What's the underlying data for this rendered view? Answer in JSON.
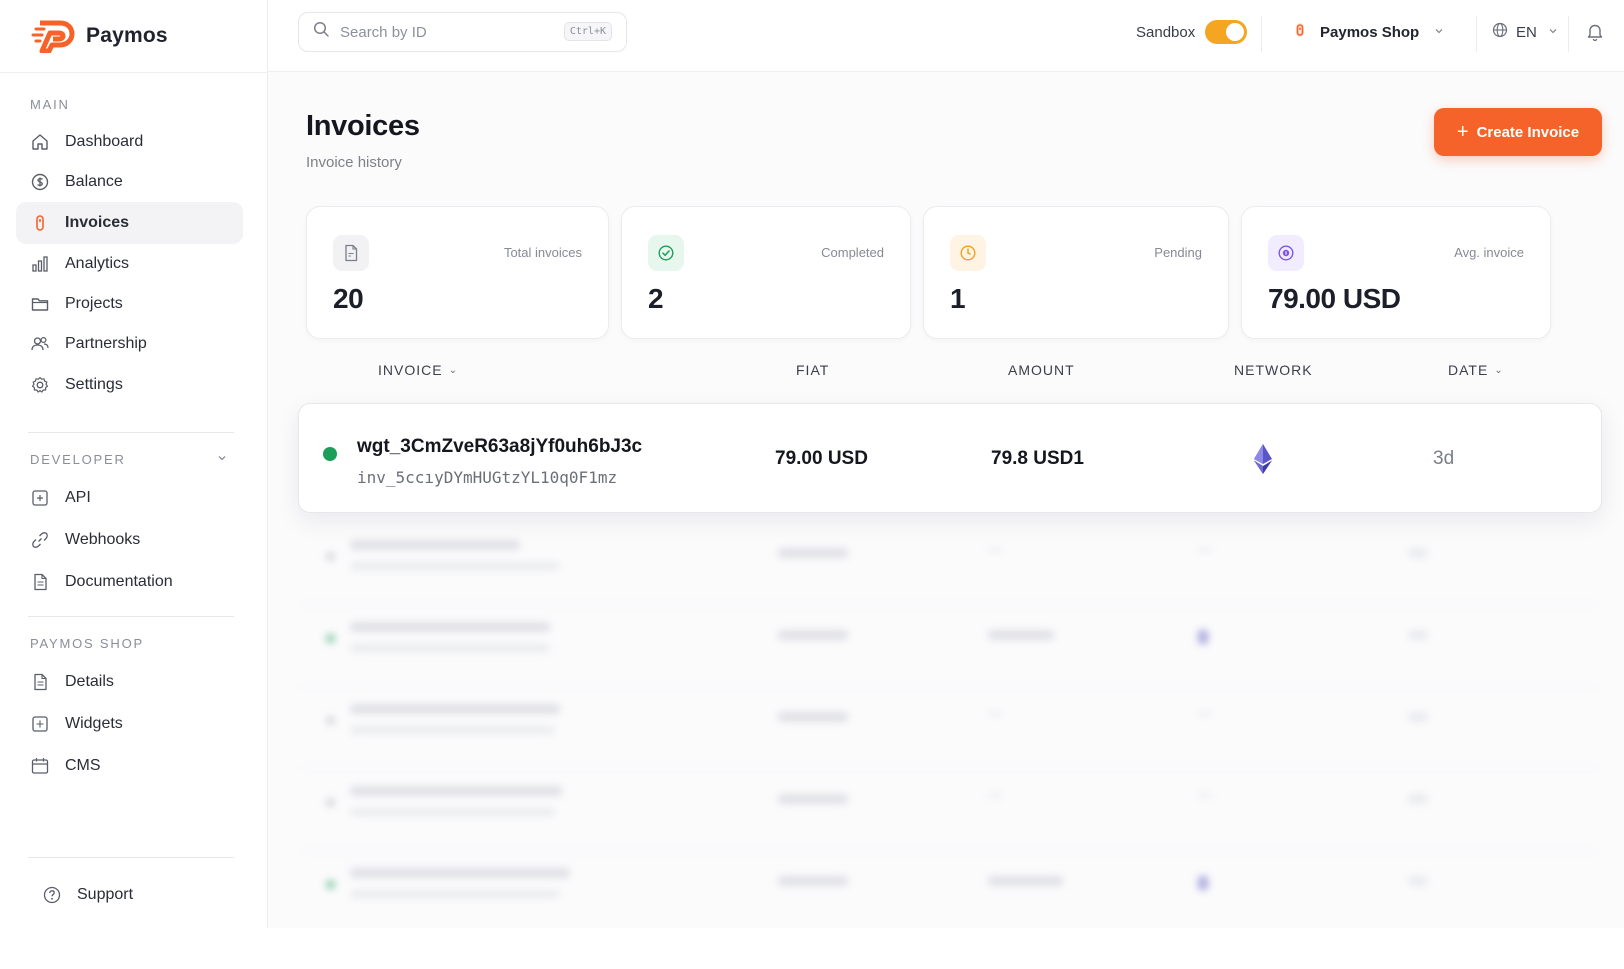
{
  "brand": {
    "name": "Paymos",
    "accent": "#f6632a"
  },
  "sidebar": {
    "main_title": "MAIN",
    "main_items": [
      {
        "label": "Dashboard",
        "icon": "home-icon"
      },
      {
        "label": "Balance",
        "icon": "dollar-icon"
      },
      {
        "label": "Invoices",
        "icon": "invoice-icon",
        "active": true
      },
      {
        "label": "Analytics",
        "icon": "chart-icon"
      },
      {
        "label": "Projects",
        "icon": "folder-icon"
      },
      {
        "label": "Partnership",
        "icon": "users-icon"
      },
      {
        "label": "Settings",
        "icon": "gear-icon"
      }
    ],
    "developer_title": "DEVELOPER",
    "developer_items": [
      {
        "label": "API",
        "icon": "api-icon"
      },
      {
        "label": "Webhooks",
        "icon": "link-icon"
      },
      {
        "label": "Documentation",
        "icon": "document-icon"
      }
    ],
    "shop_title": "PAYMOS SHOP",
    "shop_items": [
      {
        "label": "Details",
        "icon": "document-icon"
      },
      {
        "label": "Widgets",
        "icon": "widget-icon"
      },
      {
        "label": "CMS",
        "icon": "calendar-icon"
      }
    ],
    "support_label": "Support"
  },
  "topbar": {
    "search_placeholder": "Search by ID",
    "search_shortcut": "Ctrl+K",
    "sandbox_label": "Sandbox",
    "sandbox_on": true,
    "shop_name": "Paymos Shop",
    "language": "EN"
  },
  "page": {
    "title": "Invoices",
    "subtitle": "Invoice history",
    "create_button": "Create Invoice"
  },
  "stats": [
    {
      "label": "Total invoices",
      "value": "20",
      "icon": "file-icon",
      "icon_bg": "#f2f2f5",
      "icon_color": "#7a7e89"
    },
    {
      "label": "Completed",
      "value": "2",
      "icon": "check-circle-icon",
      "icon_bg": "#e8f7ee",
      "icon_color": "#1a9e5a"
    },
    {
      "label": "Pending",
      "value": "1",
      "icon": "clock-icon",
      "icon_bg": "#fff3e4",
      "icon_color": "#f0a020"
    },
    {
      "label": "Avg. invoice",
      "value": "79.00 USD",
      "icon": "coin-icon",
      "icon_bg": "#f1ecff",
      "icon_color": "#7d55e6"
    }
  ],
  "table": {
    "headers": {
      "invoice": "INVOICE",
      "fiat": "FIAT",
      "amount": "AMOUNT",
      "network": "NETWORK",
      "date": "DATE"
    },
    "focused_row": {
      "id": "wgt_3CmZveR63a8jYf0uh6bJ3c",
      "sub_id": "inv_5ccıyDYmHUGtzYL10q0F1mz",
      "fiat": "79.00 USD",
      "amount": "79.8 USD1",
      "network": "ethereum-icon",
      "date": "3d",
      "status_color": "#1a9e5a"
    }
  }
}
